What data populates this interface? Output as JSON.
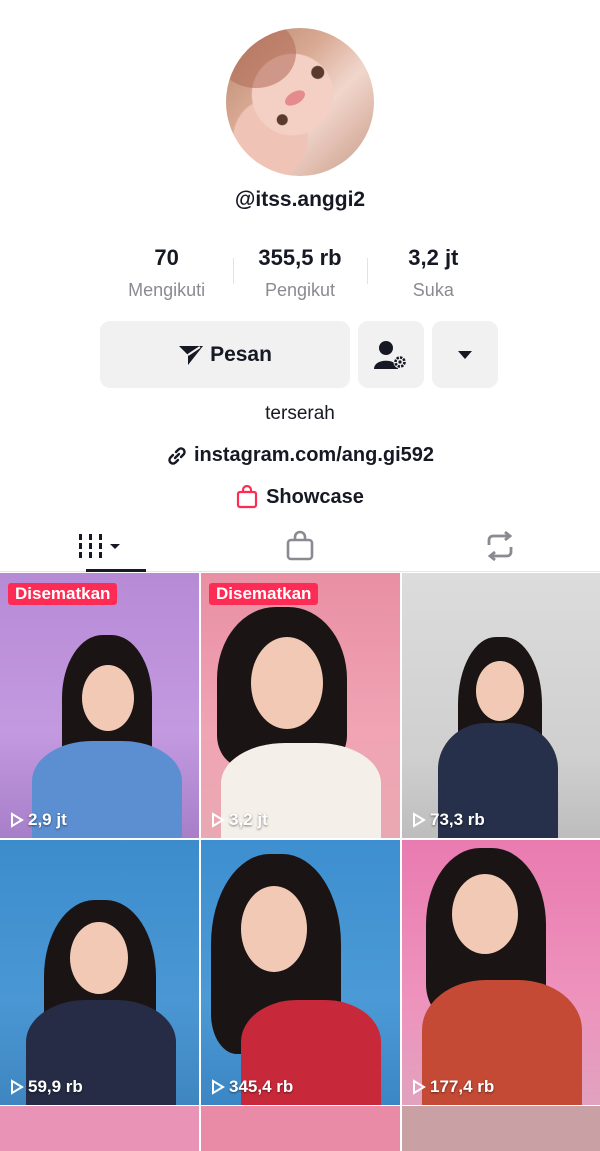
{
  "profile": {
    "username": "@itss.anggi2",
    "bio": "terserah",
    "link": "instagram.com/ang.gi592",
    "showcase_label": "Showcase"
  },
  "stats": [
    {
      "value": "70",
      "label": "Mengikuti"
    },
    {
      "value": "355,5 rb",
      "label": "Pengikut"
    },
    {
      "value": "3,2 jt",
      "label": "Suka"
    }
  ],
  "actions": {
    "message_label": "Pesan"
  },
  "icons": {
    "message": "send-icon",
    "add_friend": "user-settings-icon",
    "more": "caret-down-icon",
    "link": "link-icon",
    "showcase": "shopping-bag-icon",
    "tab_videos": "grid-icon",
    "tab_shop": "shopping-bag-icon",
    "tab_reposts": "repost-icon"
  },
  "colors": {
    "accent": "#fe2c55",
    "text": "#161823",
    "muted": "#8a8b91",
    "button_bg": "#f1f1f2"
  },
  "videos": [
    {
      "views": "2,9 jt",
      "pinned": true,
      "pin_label": "Disematkan"
    },
    {
      "views": "3,2 jt",
      "pinned": true,
      "pin_label": "Disematkan"
    },
    {
      "views": "73,3 rb",
      "pinned": false
    },
    {
      "views": "59,9 rb",
      "pinned": false
    },
    {
      "views": "345,4 rb",
      "pinned": false
    },
    {
      "views": "177,4 rb",
      "pinned": false
    }
  ]
}
